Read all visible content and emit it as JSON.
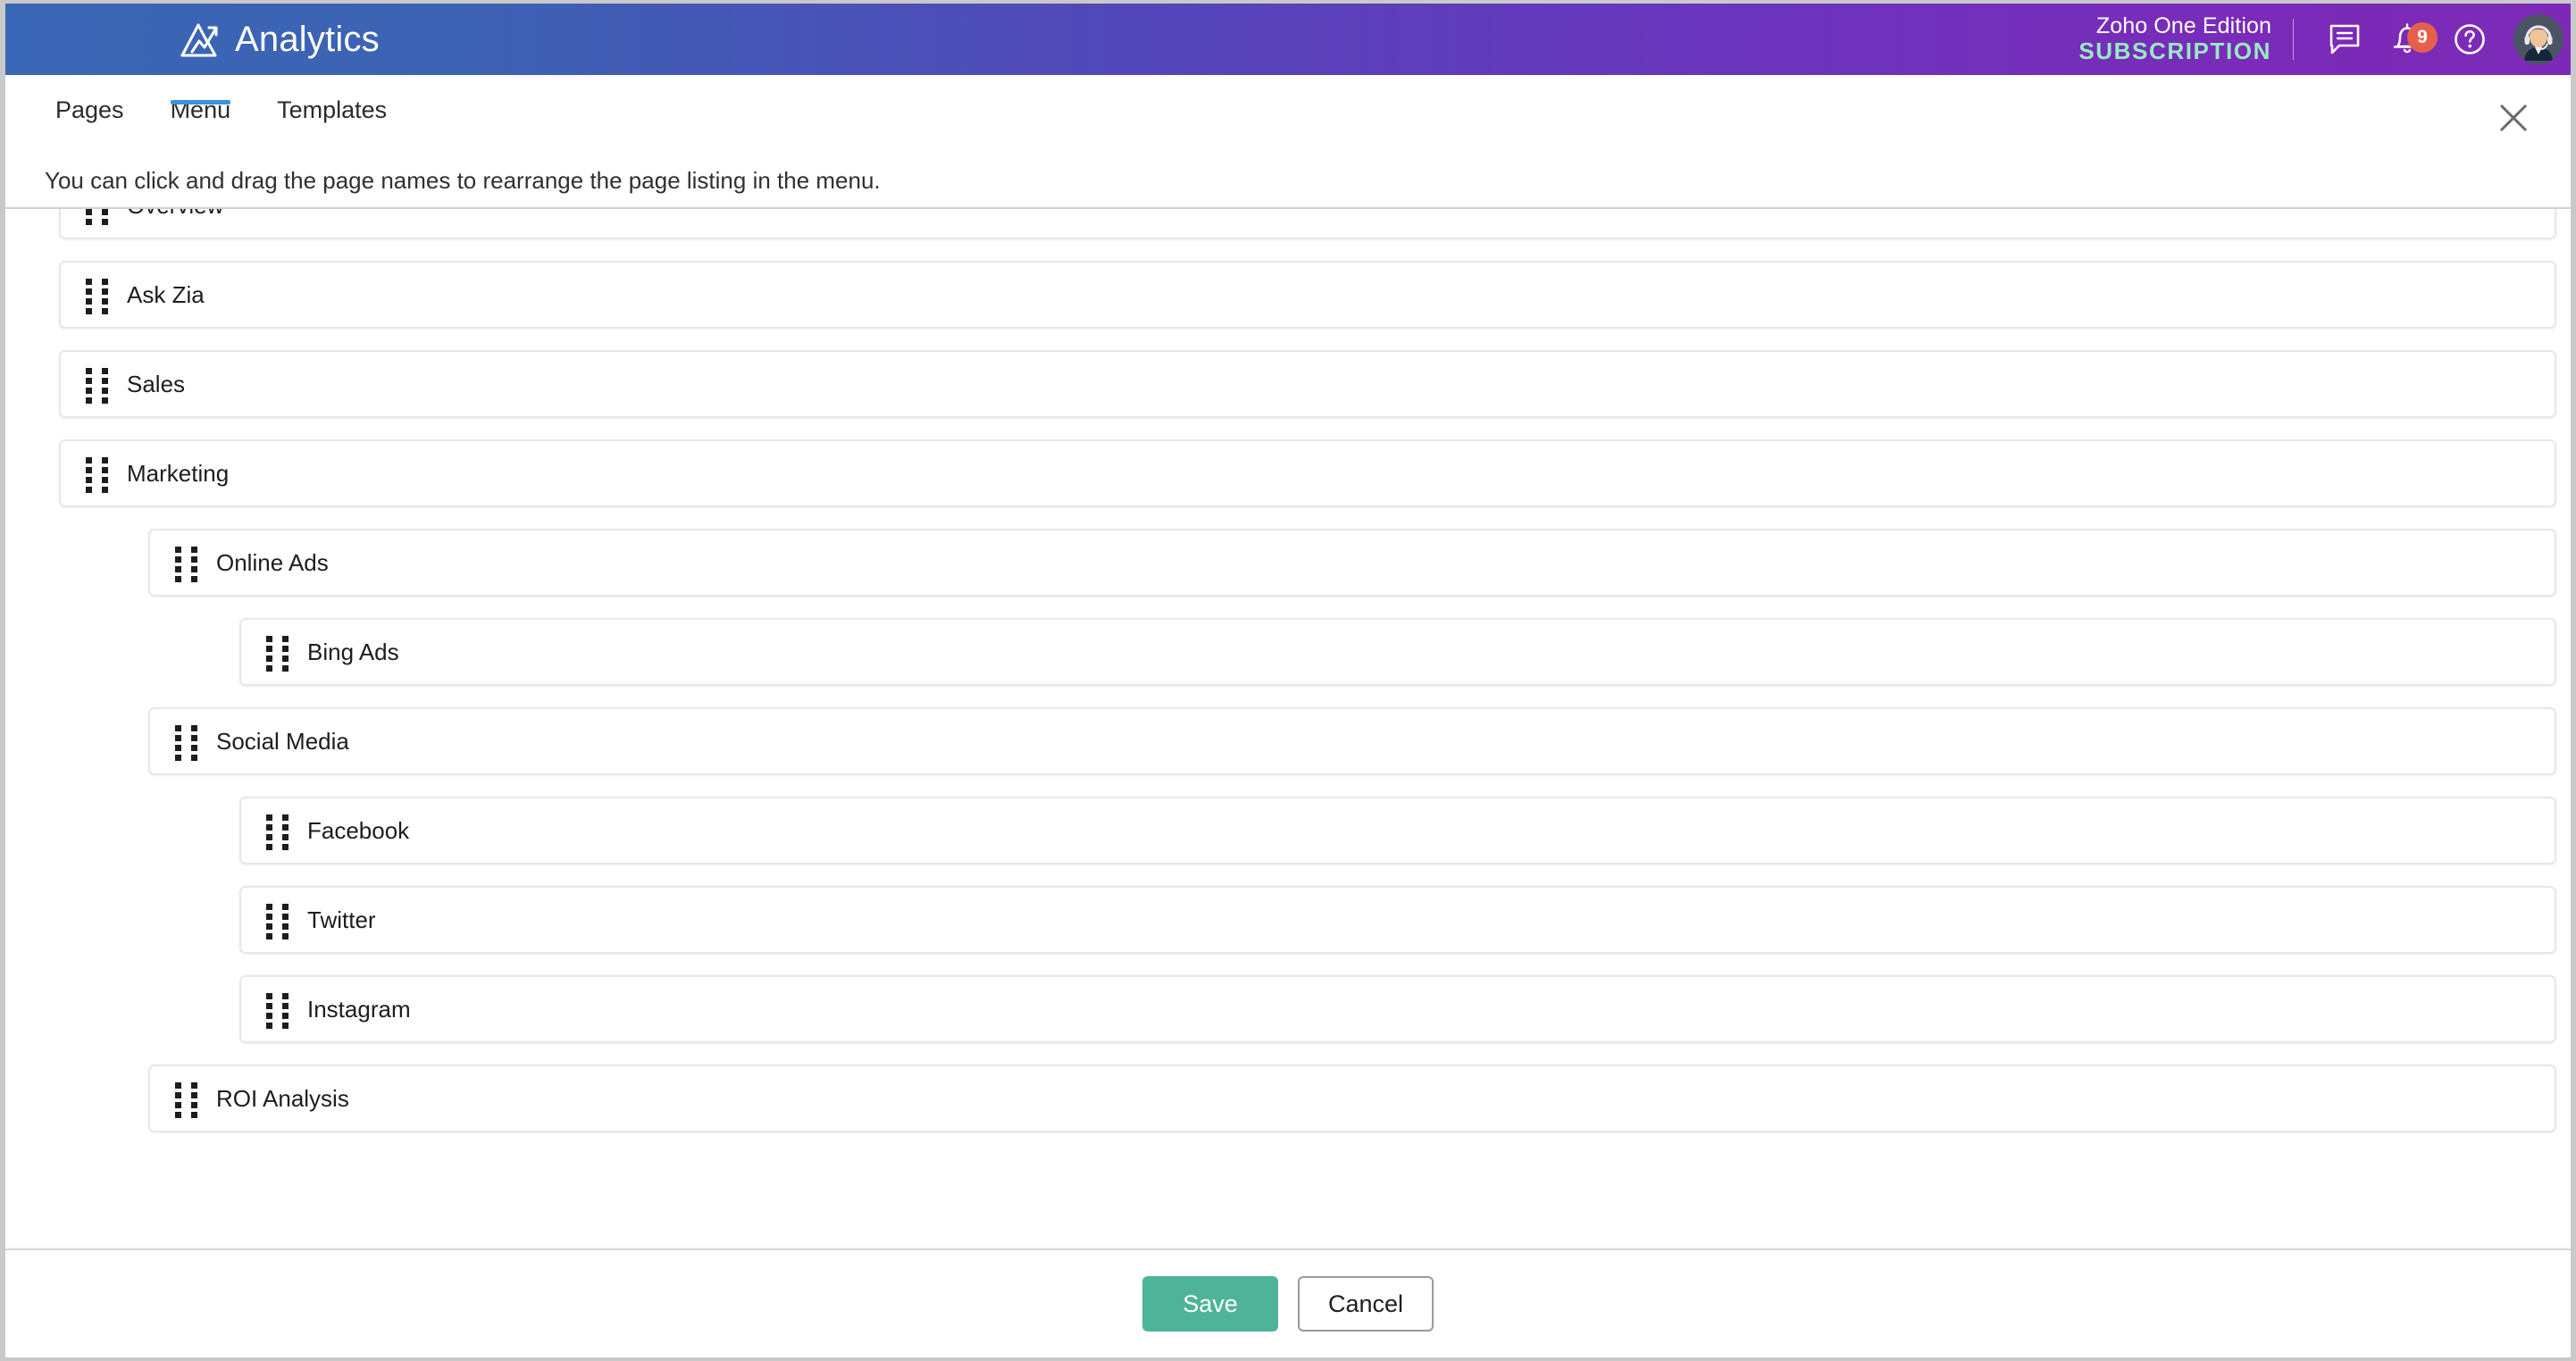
{
  "header": {
    "brand_name": "Analytics",
    "brand_logo_icon": "analytics-mountain-arrow-logo",
    "edition_line1": "Zoho One Edition",
    "edition_line2": "SUBSCRIPTION",
    "edition_accent_color": "#9AE8C4",
    "gradient_start": "#3A67B5",
    "gradient_end": "#7D29B7",
    "icons": {
      "chat": "chat-bubble-icon",
      "notifications": "bell-icon",
      "help": "help-circle-icon",
      "avatar": "user-avatar"
    },
    "notification_count": "9",
    "badge_color": "#E4604B"
  },
  "tabs": [
    {
      "label": "Pages",
      "active": false
    },
    {
      "label": "Menu",
      "active": true
    },
    {
      "label": "Templates",
      "active": false
    }
  ],
  "tab_underline_color": "#3F8FDA",
  "close_icon": "close-icon",
  "hint": "You can click and drag the page names to rearrange the page listing in the menu.",
  "pages": [
    {
      "label": "Overview",
      "level": 0
    },
    {
      "label": "Ask Zia",
      "level": 0
    },
    {
      "label": "Sales",
      "level": 0
    },
    {
      "label": "Marketing",
      "level": 0
    },
    {
      "label": "Online Ads",
      "level": 1
    },
    {
      "label": "Bing Ads",
      "level": 2
    },
    {
      "label": "Social Media",
      "level": 1
    },
    {
      "label": "Facebook",
      "level": 2
    },
    {
      "label": "Twitter",
      "level": 2
    },
    {
      "label": "Instagram",
      "level": 2
    },
    {
      "label": "ROI Analysis",
      "level": 1
    }
  ],
  "footer": {
    "save_label": "Save",
    "cancel_label": "Cancel",
    "save_color": "#4FB39A"
  }
}
